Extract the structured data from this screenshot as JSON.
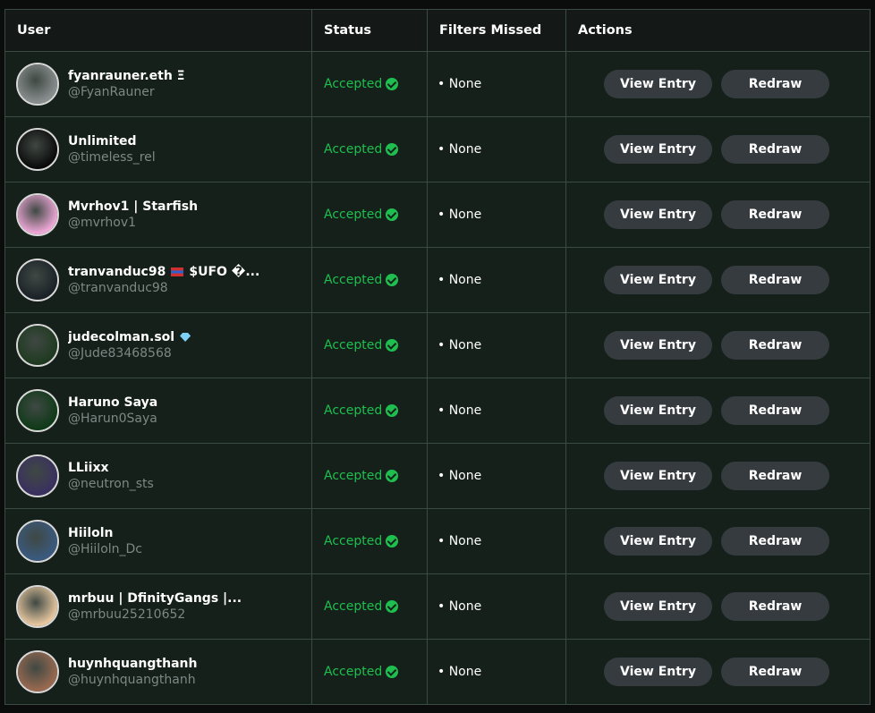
{
  "headers": {
    "user": "User",
    "status": "Status",
    "filters_missed": "Filters Missed",
    "actions": "Actions"
  },
  "rows": [
    {
      "display_name": "fyanrauner.eth Ξ",
      "handle": "@FyanRauner",
      "status": "Accepted",
      "filters": "• None",
      "view_label": "View Entry",
      "redraw_label": "Redraw",
      "avatar_color": "#8a9090"
    },
    {
      "display_name": "Unlimited",
      "handle": "@timeless_rel",
      "status": "Accepted",
      "filters": "• None",
      "view_label": "View Entry",
      "redraw_label": "Redraw",
      "avatar_color": "#0a0a0a"
    },
    {
      "display_name": "Mvrhov1 | Starfish",
      "handle": "@mvrhov1",
      "status": "Accepted",
      "filters": "• None",
      "view_label": "View Entry",
      "redraw_label": "Redraw",
      "avatar_color": "#f0a8d8"
    },
    {
      "display_name": "tranvanduc98",
      "display_suffix": "$UFO �...",
      "handle": "@tranvanduc98",
      "status": "Accepted",
      "filters": "• None",
      "view_label": "View Entry",
      "redraw_label": "Redraw",
      "avatar_color": "#1a2228"
    },
    {
      "display_name": "judecolman.sol",
      "handle": "@Jude83468568",
      "status": "Accepted",
      "filters": "• None",
      "view_label": "View Entry",
      "redraw_label": "Redraw",
      "avatar_color": "#1f3a20"
    },
    {
      "display_name": "Haruno Saya",
      "handle": "@Harun0Saya",
      "status": "Accepted",
      "filters": "• None",
      "view_label": "View Entry",
      "redraw_label": "Redraw",
      "avatar_color": "#0f3a18"
    },
    {
      "display_name": "LLiixx",
      "handle": "@neutron_sts",
      "status": "Accepted",
      "filters": "• None",
      "view_label": "View Entry",
      "redraw_label": "Redraw",
      "avatar_color": "#3a3060"
    },
    {
      "display_name": "Hiiloln",
      "handle": "@Hiiloln_Dc",
      "status": "Accepted",
      "filters": "• None",
      "view_label": "View Entry",
      "redraw_label": "Redraw",
      "avatar_color": "#3a5a80"
    },
    {
      "display_name": "mrbuu | DfinityGangs |...",
      "handle": "@mrbuu25210652",
      "status": "Accepted",
      "filters": "• None",
      "view_label": "View Entry",
      "redraw_label": "Redraw",
      "avatar_color": "#e8c8a0"
    },
    {
      "display_name": "huynhquangthanh",
      "handle": "@huynhquangthanh",
      "status": "Accepted",
      "filters": "• None",
      "view_label": "View Entry",
      "redraw_label": "Redraw",
      "avatar_color": "#9a6a50"
    }
  ],
  "colors": {
    "accepted": "#1fbf4f",
    "button_bg": "#363b40",
    "row_bg": "#15201a",
    "header_bg": "#141816"
  }
}
